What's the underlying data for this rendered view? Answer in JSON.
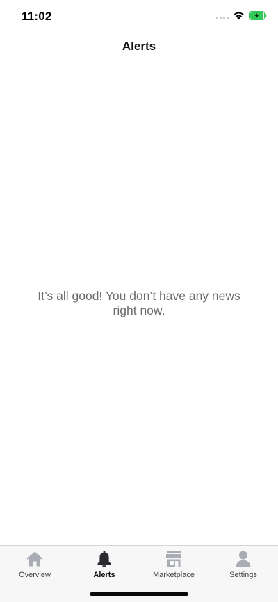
{
  "status_bar": {
    "time": "11:02",
    "icons": [
      "cellular-signal-icon",
      "wifi-icon",
      "battery-charging-icon"
    ]
  },
  "header": {
    "title": "Alerts"
  },
  "main": {
    "empty_message": "It’s all good! You don’t have any news right now."
  },
  "tab_bar": {
    "tabs": [
      {
        "label": "Overview",
        "icon": "home-icon",
        "active": false
      },
      {
        "label": "Alerts",
        "icon": "bell-icon",
        "active": true
      },
      {
        "label": "Marketplace",
        "icon": "storefront-icon",
        "active": false
      },
      {
        "label": "Settings",
        "icon": "person-icon",
        "active": false
      }
    ]
  },
  "colors": {
    "tab_inactive_icon": "#a9acb3",
    "tab_active_icon": "#2b2b2f",
    "battery_charging": "#34c759",
    "empty_text": "#6b6b6f"
  }
}
